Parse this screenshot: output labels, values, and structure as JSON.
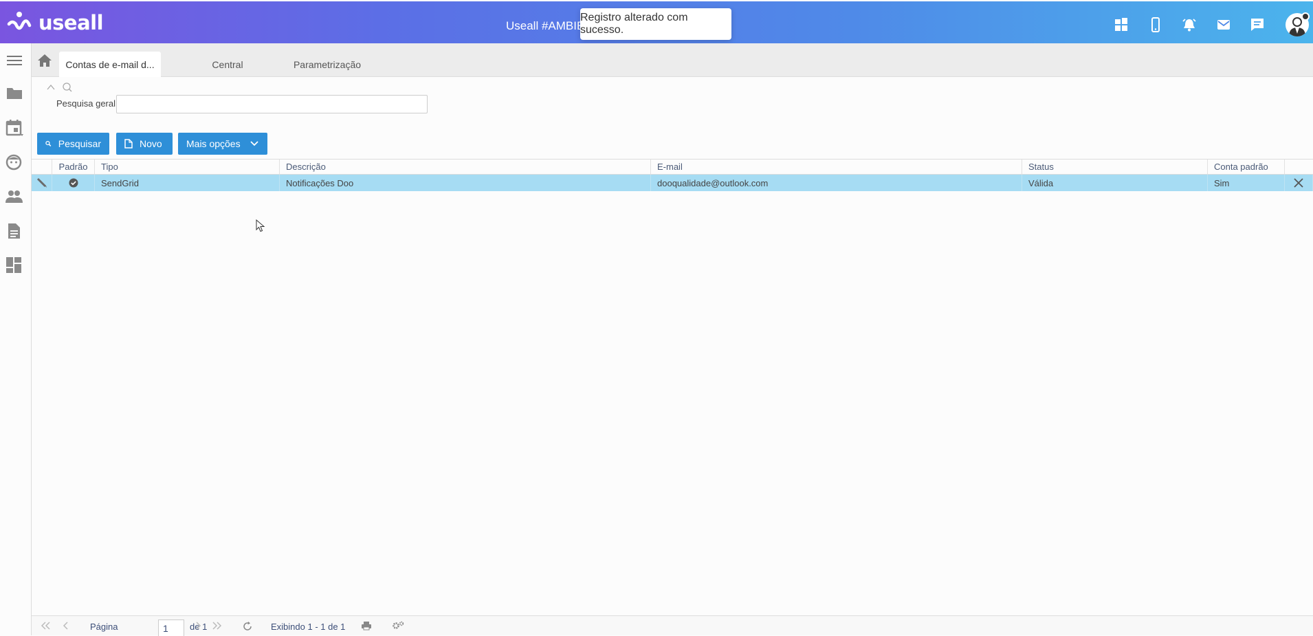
{
  "header": {
    "logo_text": "useall",
    "app_title": "Useall #AMBIEN",
    "toast": "Registro alterado com sucesso.",
    "icons": [
      "apps-icon",
      "mobile-icon",
      "alarm-icon",
      "mail-icon",
      "chat-icon",
      "user-avatar"
    ]
  },
  "sidebar": {
    "icons": [
      "menu-icon",
      "folder-icon",
      "calendar-icon",
      "face-icon",
      "people-icon",
      "document-icon",
      "dashboard-icon"
    ]
  },
  "tabs": [
    {
      "label": "Contas de e-mail d...",
      "active": true
    },
    {
      "label": "Central",
      "active": false
    },
    {
      "label": "Parametrização",
      "active": false
    }
  ],
  "search": {
    "label": "Pesquisa geral",
    "value": ""
  },
  "toolbar": {
    "search_label": "Pesquisar",
    "new_label": "Novo",
    "more_label": "Mais opções"
  },
  "grid": {
    "columns": [
      "",
      "Padrão",
      "Tipo",
      "Descrição",
      "E-mail",
      "Status",
      "Conta padrão",
      ""
    ],
    "rows": [
      {
        "tipo": "SendGrid",
        "descricao": "Notificações Doo",
        "email": "dooqualidade@outlook.com",
        "status": "Válida",
        "conta_padrao": "Sim"
      }
    ]
  },
  "pager": {
    "page_label": "Página",
    "page_value": "1",
    "of_label": "de 1",
    "display_text": "Exibindo 1 - 1 de 1"
  },
  "colors": {
    "header_start": "#7a55e0",
    "header_end": "#4bb4ec",
    "button": "#2e8fd8",
    "row_selected": "#a6dcf3"
  }
}
